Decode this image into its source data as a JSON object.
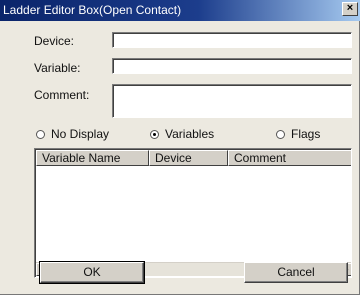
{
  "window": {
    "title": "Ladder Editor Box(Open Contact)",
    "close_label": "×"
  },
  "form": {
    "device_label": "Device:",
    "device_value": "",
    "variable_label": "Variable:",
    "variable_value": "",
    "comment_label": "Comment:",
    "comment_value": ""
  },
  "display_mode": {
    "options": [
      "No Display",
      "Variables",
      "Flags"
    ],
    "selected": "Variables"
  },
  "list": {
    "columns": [
      "Variable Name",
      "Device",
      "Comment"
    ],
    "rows": [],
    "scroll_left_icon": "◀",
    "scroll_right_icon": "▶"
  },
  "buttons": {
    "ok": "OK",
    "cancel": "Cancel"
  }
}
